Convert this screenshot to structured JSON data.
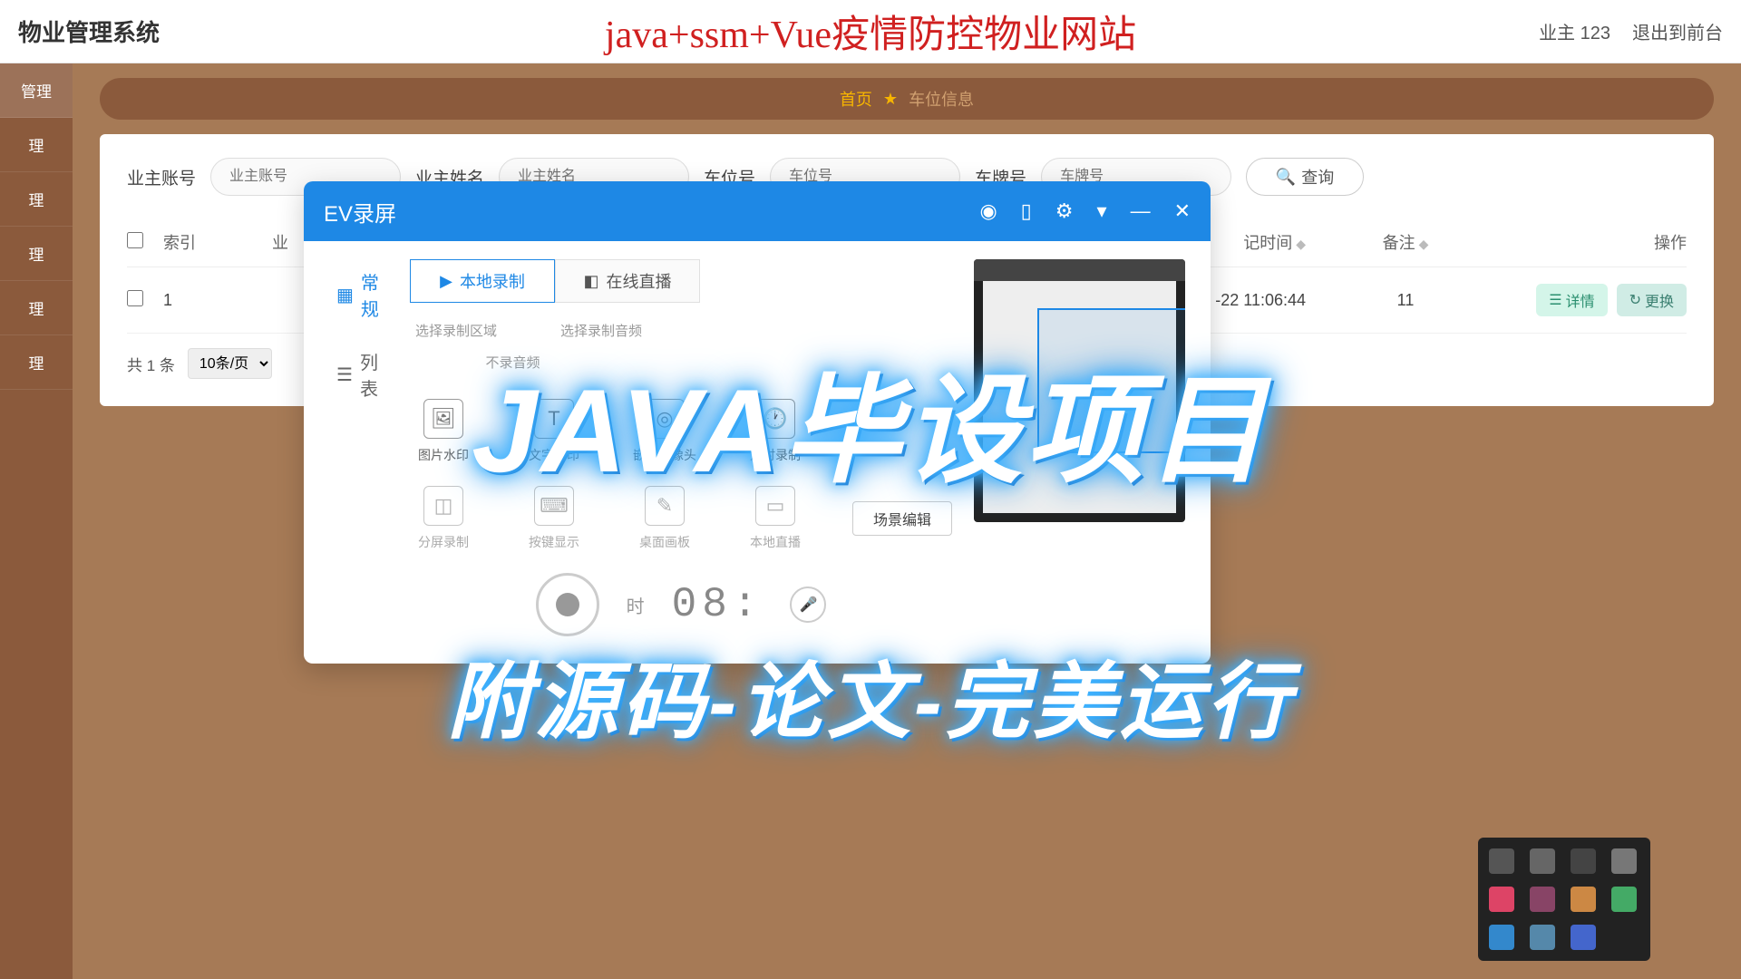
{
  "header": {
    "logo": "物业管理系统",
    "banner": "java+ssm+Vue疫情防控物业网站",
    "user": "业主 123",
    "logout": "退出到前台"
  },
  "sidebar": {
    "items": [
      "管理",
      "理",
      "理",
      "理",
      "理",
      "理"
    ]
  },
  "breadcrumb": {
    "home": "首页",
    "current": "车位信息"
  },
  "filters": {
    "f1_label": "业主账号",
    "f1_ph": "业主账号",
    "f2_label": "业主姓名",
    "f2_ph": "业主姓名",
    "f3_label": "车位号",
    "f3_ph": "车位号",
    "f4_label": "车牌号",
    "f4_ph": "车牌号",
    "query": "查询"
  },
  "table": {
    "col_index": "索引",
    "col_account": "业",
    "col_time": "记时间",
    "col_note": "备注",
    "col_ops": "操作",
    "row1_idx": "1",
    "row1_time": "-22 11:06:44",
    "row1_note": "11",
    "btn_detail": "详情",
    "btn_edit": "更换"
  },
  "pager": {
    "total": "共 1 条",
    "perpage": "10条/页"
  },
  "ev": {
    "title": "EV录屏",
    "left1": "常规",
    "left2": "列表",
    "tab1": "本地录制",
    "tab2": "在线直播",
    "sub1": "选择录制区域",
    "sub2": "选择录制音频",
    "sub3": "不录音频",
    "tools1": [
      "图片水印",
      "文字水印",
      "嵌入摄像头",
      "定时录制"
    ],
    "tools2": [
      "分屏录制",
      "按键显示",
      "桌面画板",
      "本地直播"
    ],
    "scene": "场景编辑",
    "timer_label": "时",
    "timer": "08:"
  },
  "overlay": {
    "line1": "JAVA毕设项目",
    "line2": "附源码-论文-完美运行"
  }
}
